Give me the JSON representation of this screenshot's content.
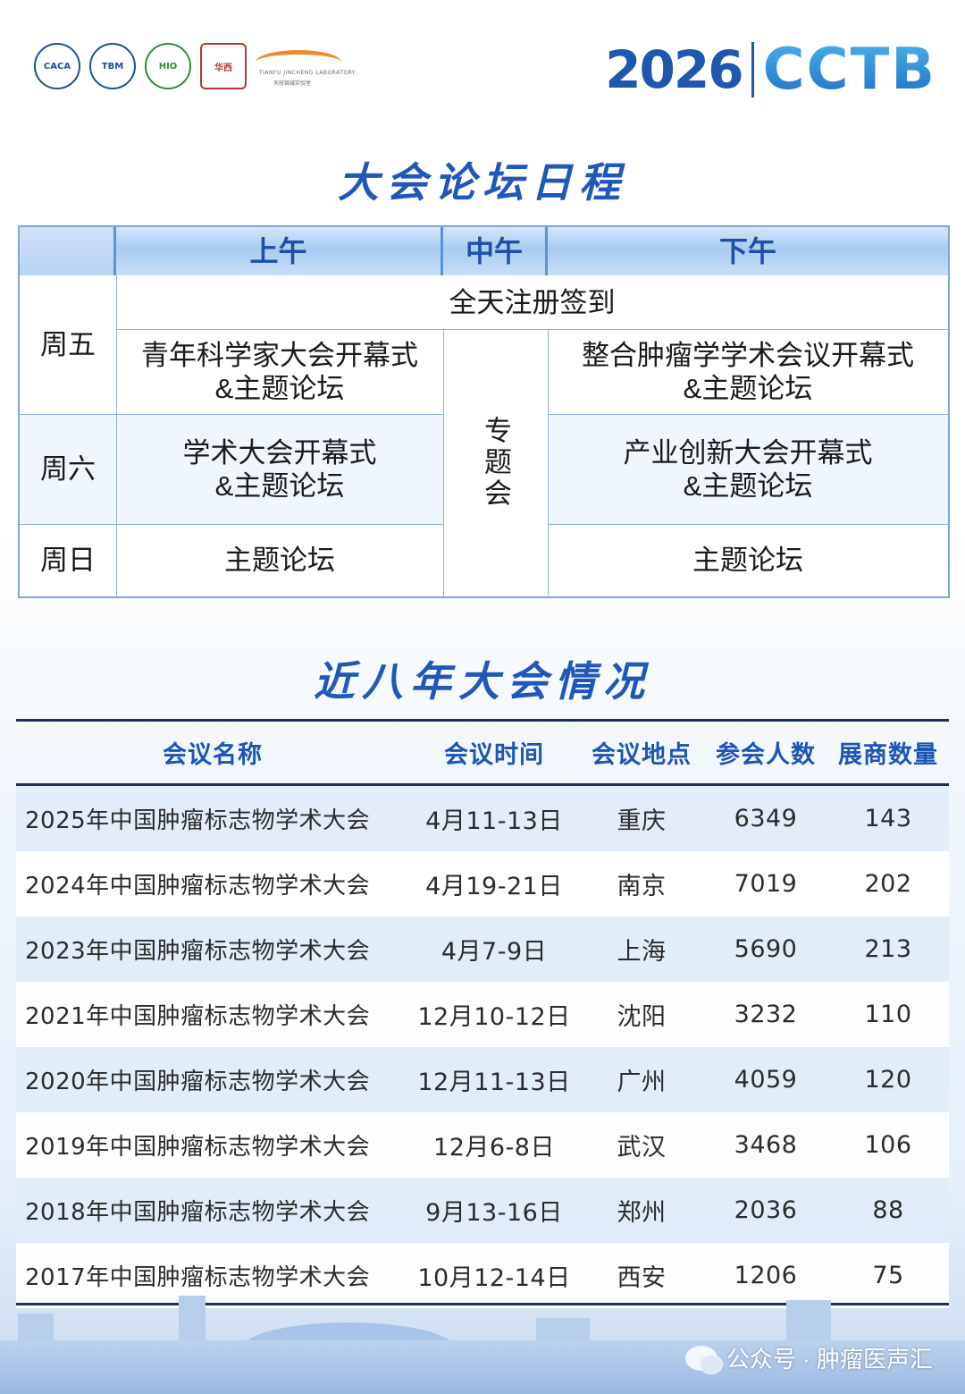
{
  "header": {
    "logos": [
      {
        "name": "china-anti-cancer-association-logo",
        "text": "CACA"
      },
      {
        "name": "tbm-logo",
        "text": "TBM"
      },
      {
        "name": "hio-logo",
        "text": "HIO"
      },
      {
        "name": "hospital-logo",
        "text": "华西"
      },
      {
        "name": "tianfu-jincheng-laboratory-logo",
        "text": "TIANFU JINCHENG LABORATORY",
        "subtext": "天府锦城实验室"
      }
    ],
    "year": "2026",
    "brand": "CCTB"
  },
  "schedule": {
    "title": "大会论坛日程",
    "columns": [
      "上午",
      "中午",
      "下午"
    ],
    "days": {
      "fri": "周五",
      "sat": "周六",
      "sun": "周日"
    },
    "registration": "全天注册签到",
    "fri_morning": [
      "青年科学家大会开幕式",
      "&主题论坛"
    ],
    "fri_afternoon": [
      "整合肿瘤学学术会议开幕式",
      "&主题论坛"
    ],
    "sat_morning": [
      "学术大会开幕式",
      "&主题论坛"
    ],
    "sat_afternoon": [
      "产业创新大会开幕式",
      "&主题论坛"
    ],
    "noon": "专题会",
    "sun_morning": "主题论坛",
    "sun_afternoon": "主题论坛"
  },
  "history": {
    "title": "近八年大会情况",
    "headers": [
      "会议名称",
      "会议时间",
      "会议地点",
      "参会人数",
      "展商数量"
    ],
    "rows": [
      [
        "2025年中国肿瘤标志物学术大会",
        "4月11-13日",
        "重庆",
        "6349",
        "143"
      ],
      [
        "2024年中国肿瘤标志物学术大会",
        "4月19-21日",
        "南京",
        "7019",
        "202"
      ],
      [
        "2023年中国肿瘤标志物学术大会",
        "4月7-9日",
        "上海",
        "5690",
        "213"
      ],
      [
        "2021年中国肿瘤标志物学术大会",
        "12月10-12日",
        "沈阳",
        "3232",
        "110"
      ],
      [
        "2020年中国肿瘤标志物学术大会",
        "12月11-13日",
        "广州",
        "4059",
        "120"
      ],
      [
        "2019年中国肿瘤标志物学术大会",
        "12月6-8日",
        "武汉",
        "3468",
        "106"
      ],
      [
        "2018年中国肿瘤标志物学术大会",
        "9月13-16日",
        "郑州",
        "2036",
        "88"
      ],
      [
        "2017年中国肿瘤标志物学术大会",
        "10月12-14日",
        "西安",
        "1206",
        "75"
      ]
    ]
  },
  "watermark": "公众号 · 肿瘤医声汇"
}
